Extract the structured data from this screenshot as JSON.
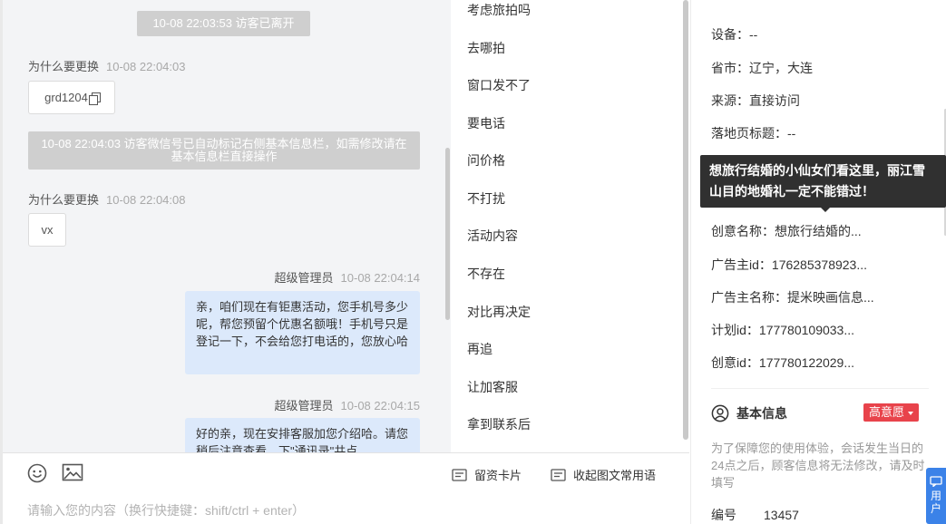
{
  "chat": {
    "system_left": "10-08 22:03:53 访客已离开",
    "system_wechat": "10-08 22:04:03 访客微信号已自动标记右侧基本信息栏，如需修改请在基本信息栏直接操作",
    "messages": [
      {
        "sender": "为什么要更换",
        "time": "10-08 22:04:03",
        "text": "grd1204"
      },
      {
        "sender": "为什么要更换",
        "time": "10-08 22:04:08",
        "text": "vx"
      },
      {
        "sender": "超级管理员",
        "time": "10-08 22:04:14",
        "text": "亲，咱们现在有钜惠活动，您手机号多少呢，帮您预留个优惠名额哦！手机号只是登记一下，不会给您打电话的，您放心哈"
      },
      {
        "sender": "超级管理员",
        "time": "10-08 22:04:15",
        "text": "好的亲，现在安排客服加您介绍哈。请您稍后注意查看，下\"通讯录\"共点"
      }
    ]
  },
  "toolbar": {
    "card_label": "留资卡片",
    "collapse_label": "收起图文常用语",
    "input_placeholder": "请输入您的内容（换行快捷键：shift/ctrl + enter）"
  },
  "quick_replies": [
    "考虑旅拍吗",
    "去哪拍",
    "窗口发不了",
    "要电话",
    "问价格",
    "不打扰",
    "活动内容",
    "不存在",
    "对比再决定",
    "再追",
    "让加客服",
    "拿到联系后"
  ],
  "info": {
    "rows": [
      {
        "label": "设备：",
        "value": "--"
      },
      {
        "label": "省市：",
        "value": "辽宁，大连"
      },
      {
        "label": "来源：",
        "value": "直接访问"
      },
      {
        "label": "落地页标题：",
        "value": "--"
      },
      {
        "label": "创意名称：",
        "value": "想旅行结婚的..."
      },
      {
        "label": "广告主id：",
        "value": "176285378923..."
      },
      {
        "label": "广告主名称：",
        "value": "提米映画信息..."
      },
      {
        "label": "计划id：",
        "value": "177780109033..."
      },
      {
        "label": "创意id：",
        "value": "177780122029..."
      }
    ],
    "tooltip": "想旅行结婚的小仙女们看这里，丽江雪山目的地婚礼一定不能错过！",
    "basic_title": "基本信息",
    "intent_badge": "高意愿",
    "notice": "为了保障您的使用体验，会话发生当日的24点之后，顾客信息将无法修改，请及时填写",
    "id_label": "编号",
    "id_value": "13457"
  },
  "float_button": {
    "label": "用户"
  },
  "colors": {
    "accent": "#3b82e8",
    "agent_bubble": "#dce9fb",
    "intent_badge": "#e8434b"
  }
}
